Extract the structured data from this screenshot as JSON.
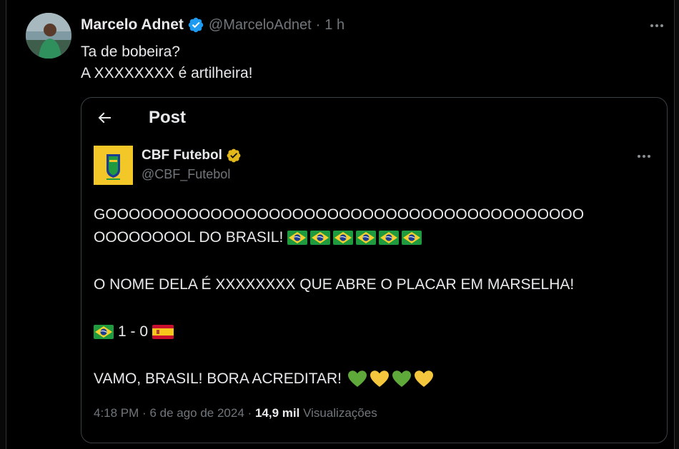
{
  "tweet": {
    "author_name": "Marcelo Adnet",
    "handle": "@MarceloAdnet",
    "separator": "·",
    "time": "1 h",
    "lines": [
      "Ta de bobeira?",
      "A XXXXXXXX é artilheira!"
    ]
  },
  "quoted": {
    "header_title": "Post",
    "author_name": "CBF Futebol",
    "handle": "@CBF_Futebol",
    "lines": {
      "l1": "GOOOOOOOOOOOOOOOOOOOOOOOOOOOOOOOOOOOOOOOOO",
      "l2": "OOOOOOOOL DO BRASIL!",
      "l3": "O NOME DELA É XXXXXXXX QUE ABRE O PLACAR EM MARSELHA!",
      "l4": "1 - 0",
      "l5": "VAMO, BRASIL! BORA ACREDITAR!"
    },
    "meta": {
      "time": "4:18 PM",
      "date": "6 de ago de 2024",
      "sep": "·",
      "views_count": "14,9 mil",
      "views_label": "Visualizações"
    }
  },
  "colors": {
    "background": "#000000",
    "text": "#e7e9ea",
    "muted": "#71767b",
    "verified_blue": "#1d9bf0",
    "verified_gold": "#e2b719",
    "border": "#2f3336"
  },
  "icons": [
    "verified-badge-icon",
    "more-icon",
    "back-arrow-icon",
    "brazil-flag-icon",
    "spain-flag-icon",
    "green-heart-icon",
    "yellow-heart-icon"
  ]
}
